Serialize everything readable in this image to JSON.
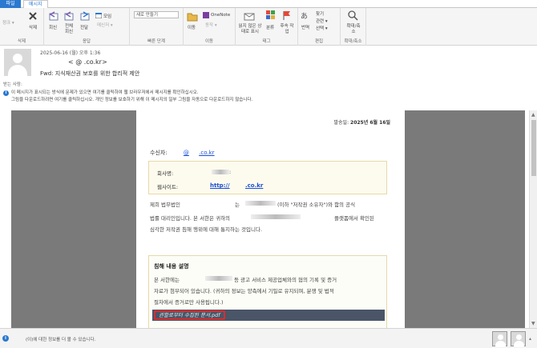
{
  "tabs": {
    "file": "파일",
    "message": "메시지"
  },
  "ribbon": {
    "junk": "정크 ▾",
    "delete": "삭제",
    "reply": "회신",
    "reply_all": "전체 회신",
    "forward": "전달",
    "meeting": "모임",
    "im": "메신저 ▾",
    "new_quick": "새로 만들기",
    "move": "이동",
    "onenote": "OneNote",
    "actions": "동작 ▾",
    "mark_unread": "읽지 않은 상태로 표시",
    "categorize": "분류",
    "followup": "후속 작업",
    "translate": "번역",
    "find": "찾기",
    "related": "관련 ▾",
    "select": "선택 ▾",
    "zoom": "확대/축소",
    "groups": {
      "delete": "삭제",
      "respond": "응답",
      "quick_steps": "빠른 단계",
      "move": "이동",
      "tags": "태그",
      "edit": "편집",
      "zoom": "확대/축소"
    }
  },
  "header": {
    "date": "2025-06-16 (월) 오후 1:36",
    "sender": "<          @         .co.kr>",
    "subject": "Fwd: 지식재산권 보호를 위한 합리적 제안",
    "recipients_label": "받는 사람:"
  },
  "info_bar": {
    "line1": "이 메시지가 표시되는 방식에 문제가 있으면 여기를 클릭하여 웹 브라우저에서 메시지를 확인하십시오.",
    "line2": "그림을 다운로드하려면 여기를 클릭하십시오. 개인 정보를 보호하기 위해 이 메시지의 일부 그림을 자동으로 다운로드하지 않습니다."
  },
  "letter": {
    "issue_label": "발송일:",
    "issue_date": "2025년 6월 16일",
    "recipient_label": "수신자:",
    "recipient_link_a": "@",
    "recipient_link_b": ".co.kr",
    "company_label": "회사명:",
    "company_colon": ":",
    "website_label": "웹사이트:",
    "website_a": "http://",
    "website_b": ".co.kr",
    "para1_a": "제희 법무법인",
    "para1_b": "는",
    "para1_c": "(이하 \"저작권 소유자\")와 함의 공식",
    "para2_a": "법률 대리인입니다. 본 서한은 귀하의",
    "para2_b": "플랫폼에서 확인된",
    "para3": "심각한 저작권 침해 행위에 대해 통지하는 것입니다.",
    "violation_title": "침해 내용 설명",
    "v1_a": "본 서한에는",
    "v1_b": "등 광고 서비스 제공업체와의 협의 기록 및 증거",
    "v2": "자료가 첨부되어 있습니다. (귀하의 정보는 양측에서 기밀로 유지되며, 분쟁 및 법적",
    "v3": "절차에서 증거로만 사용됩니다.)",
    "attachment": "권할로부터 수집된 문서.pdf"
  },
  "footer": {
    "text": "(이)에 대한 정보를 더 볼 수 있습니다."
  },
  "colors": {
    "accent": "#2b79d0",
    "link": "#1a4fd6",
    "band": "#7a7a7a",
    "attach_bar": "#4a5568",
    "highlight": "#d32f2f"
  }
}
